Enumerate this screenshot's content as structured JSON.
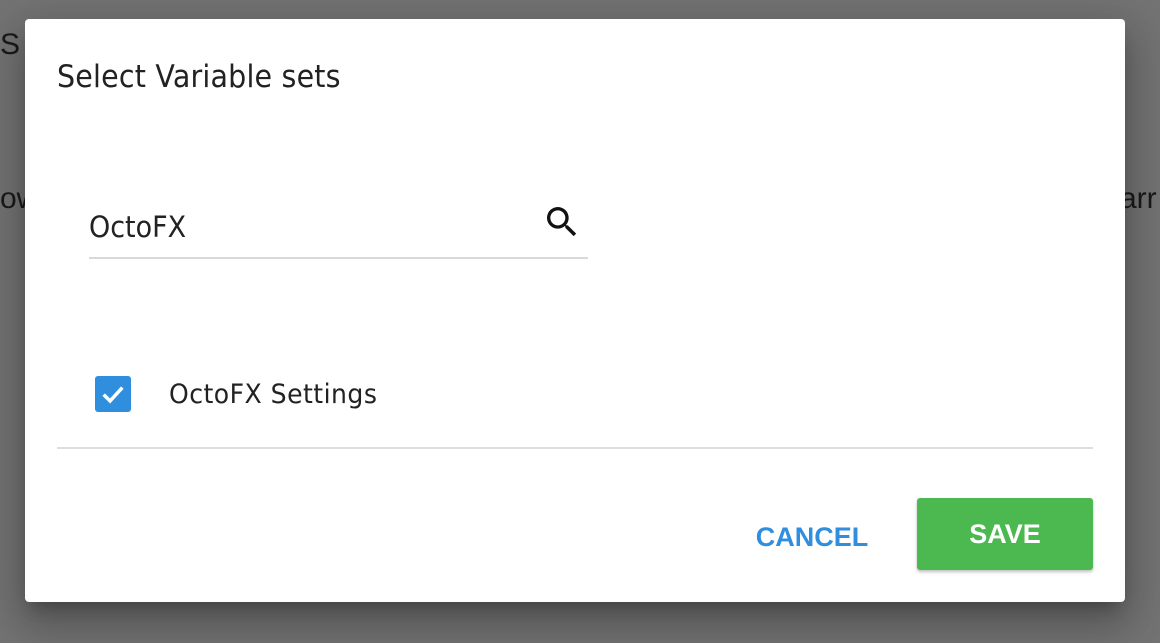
{
  "background": {
    "fragments": [
      "S",
      "ow",
      "arr"
    ]
  },
  "dialog": {
    "title": "Select Variable sets",
    "search": {
      "value": "OctoFX",
      "icon": "search-icon"
    },
    "options": [
      {
        "label": "OctoFX Settings",
        "checked": true
      }
    ],
    "actions": {
      "cancel_label": "CANCEL",
      "save_label": "SAVE"
    }
  },
  "colors": {
    "accent": "#2f8fde",
    "save": "#4cb950",
    "overlay": "#737373"
  }
}
